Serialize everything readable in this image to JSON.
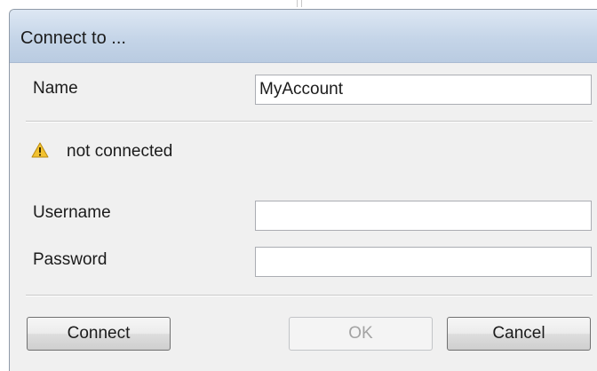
{
  "dialog": {
    "title": "Connect to ..."
  },
  "fields": {
    "name_label": "Name",
    "name_value": "MyAccount",
    "username_label": "Username",
    "username_value": "",
    "password_label": "Password",
    "password_value": ""
  },
  "status": {
    "icon": "warning-icon",
    "text": "not connected",
    "icon_color": "#f2c230"
  },
  "buttons": {
    "connect_label": "Connect",
    "ok_label": "OK",
    "ok_enabled": false,
    "cancel_label": "Cancel"
  }
}
